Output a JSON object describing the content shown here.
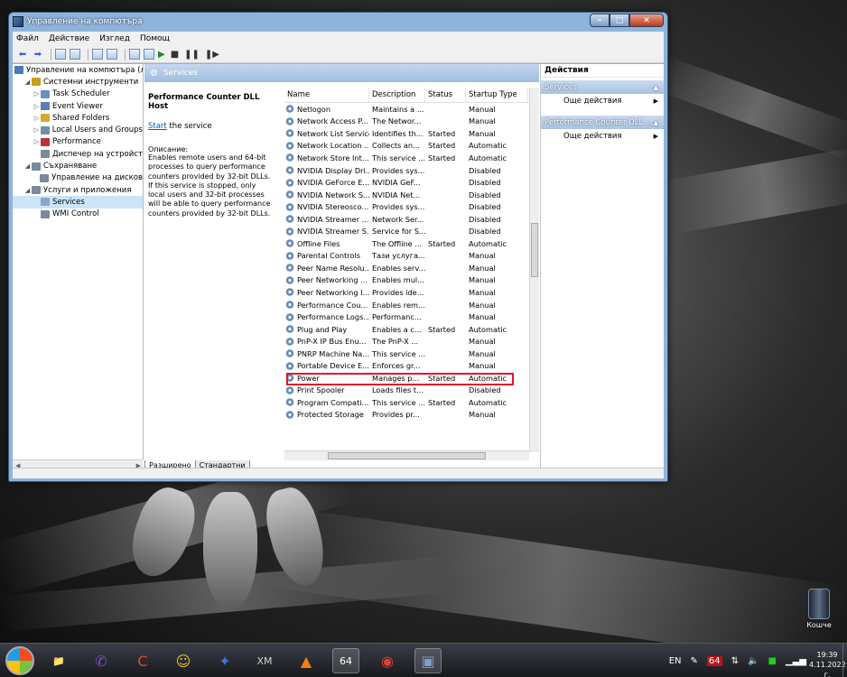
{
  "window": {
    "title": "Управление на компютъра",
    "controls": {
      "minimize": "–",
      "maximize": "□",
      "close": "✕"
    }
  },
  "menu": [
    "Файл",
    "Действие",
    "Изглед",
    "Помощ"
  ],
  "tree": [
    {
      "label": "Управление на компютъра (л",
      "level": 0,
      "expander": "",
      "icon_color": "#4a7ab8"
    },
    {
      "label": "Системни инструменти",
      "level": 1,
      "expander": "◢",
      "icon_color": "#c8a020"
    },
    {
      "label": "Task Scheduler",
      "level": 2,
      "expander": "▷",
      "icon_color": "#6a8fbf"
    },
    {
      "label": "Event Viewer",
      "level": 2,
      "expander": "▷",
      "icon_color": "#5a7fb0"
    },
    {
      "label": "Shared Folders",
      "level": 2,
      "expander": "▷",
      "icon_color": "#d7a832"
    },
    {
      "label": "Local Users and Groups",
      "level": 2,
      "expander": "▷",
      "icon_color": "#6f8fa8"
    },
    {
      "label": "Performance",
      "level": 2,
      "expander": "▷",
      "icon_color": "#c03030"
    },
    {
      "label": "Диспечер на устройст",
      "level": 2,
      "expander": "",
      "icon_color": "#7a8a9a"
    },
    {
      "label": "Съхраняване",
      "level": 1,
      "expander": "◢",
      "icon_color": "#7a8a9a"
    },
    {
      "label": "Управление на дисков",
      "level": 2,
      "expander": "",
      "icon_color": "#7a8a9a"
    },
    {
      "label": "Услуги и приложения",
      "level": 1,
      "expander": "◢",
      "icon_color": "#7a8a9a"
    },
    {
      "label": "Services",
      "level": 2,
      "expander": "",
      "icon_color": "#8aa8c8",
      "selected": true
    },
    {
      "label": "WMI Control",
      "level": 2,
      "expander": "",
      "icon_color": "#7a8a9a"
    }
  ],
  "center": {
    "header": "Services",
    "selected_service_title": "Performance Counter DLL Host",
    "start_link": "Start",
    "start_rest": " the service",
    "description_label": "Описание:",
    "description": "Enables remote users and 64-bit processes to query performance counters provided by 32-bit DLLs. If this service is stopped, only local users and 32-bit processes will be able to query performance counters provided by 32-bit DLLs.",
    "columns": {
      "name": "Name",
      "description": "Description",
      "status": "Status",
      "startup": "Startup Type"
    },
    "rows": [
      {
        "name": "Netlogon",
        "description": "Maintains a ...",
        "status": "",
        "startup": "Manual"
      },
      {
        "name": "Network Access P...",
        "description": "The Networ...",
        "status": "",
        "startup": "Manual"
      },
      {
        "name": "Network List Service",
        "description": "Identifies th...",
        "status": "Started",
        "startup": "Manual"
      },
      {
        "name": "Network Location ...",
        "description": "Collects an...",
        "status": "Started",
        "startup": "Automatic"
      },
      {
        "name": "Network Store Int...",
        "description": "This service ...",
        "status": "Started",
        "startup": "Automatic"
      },
      {
        "name": "NVIDIA Display Dri...",
        "description": "Provides sys...",
        "status": "",
        "startup": "Disabled"
      },
      {
        "name": "NVIDIA GeForce E...",
        "description": "NVIDIA GeF...",
        "status": "",
        "startup": "Disabled"
      },
      {
        "name": "NVIDIA Network S...",
        "description": "NVIDIA Net...",
        "status": "",
        "startup": "Disabled"
      },
      {
        "name": "NVIDIA Stereosco...",
        "description": "Provides sys...",
        "status": "",
        "startup": "Disabled"
      },
      {
        "name": "NVIDIA Streamer ...",
        "description": "Network Ser...",
        "status": "",
        "startup": "Disabled"
      },
      {
        "name": "NVIDIA Streamer S...",
        "description": "Service for S...",
        "status": "",
        "startup": "Disabled"
      },
      {
        "name": "Offline Files",
        "description": "The Offline ...",
        "status": "Started",
        "startup": "Automatic"
      },
      {
        "name": "Parental Controls",
        "description": "Тази услуга...",
        "status": "",
        "startup": "Manual"
      },
      {
        "name": "Peer Name Resolu...",
        "description": "Enables serv...",
        "status": "",
        "startup": "Manual"
      },
      {
        "name": "Peer Networking ...",
        "description": "Enables mul...",
        "status": "",
        "startup": "Manual"
      },
      {
        "name": "Peer Networking I...",
        "description": "Provides ide...",
        "status": "",
        "startup": "Manual"
      },
      {
        "name": "Performance Cou...",
        "description": "Enables rem...",
        "status": "",
        "startup": "Manual",
        "highlighted": true
      },
      {
        "name": "Performance Logs...",
        "description": "Performanc...",
        "status": "",
        "startup": "Manual"
      },
      {
        "name": "Plug and Play",
        "description": "Enables a c...",
        "status": "Started",
        "startup": "Automatic"
      },
      {
        "name": "PnP-X IP Bus Enu...",
        "description": "The PnP-X ...",
        "status": "",
        "startup": "Manual"
      },
      {
        "name": "PNRP Machine Na...",
        "description": "This service ...",
        "status": "",
        "startup": "Manual"
      },
      {
        "name": "Portable Device E...",
        "description": "Enforces gr...",
        "status": "",
        "startup": "Manual"
      },
      {
        "name": "Power",
        "description": "Manages p...",
        "status": "Started",
        "startup": "Automatic"
      },
      {
        "name": "Print Spooler",
        "description": "Loads files t...",
        "status": "",
        "startup": "Disabled"
      },
      {
        "name": "Program Compati...",
        "description": "This service ...",
        "status": "Started",
        "startup": "Automatic"
      },
      {
        "name": "Protected Storage",
        "description": "Provides pr...",
        "status": "",
        "startup": "Manual"
      }
    ],
    "tabs": [
      "Разширено",
      "Стандартни"
    ]
  },
  "actions": {
    "title": "Действия",
    "groups": [
      {
        "name": "Services",
        "more": "Още действия"
      },
      {
        "name": "Performance Counter DLL ...",
        "more": "Още действия"
      }
    ]
  },
  "taskbar": {
    "apps": [
      {
        "name": "explorer-icon",
        "glyph": "📁",
        "color": "#e2b44a"
      },
      {
        "name": "viber-icon",
        "glyph": "✆",
        "color": "#7d4ed1"
      },
      {
        "name": "ccleaner-icon",
        "glyph": "C",
        "color": "#d94a2e"
      },
      {
        "name": "yahoo-messenger-icon",
        "glyph": "☺",
        "color": "#f0c020"
      },
      {
        "name": "game-icon",
        "glyph": "✦",
        "color": "#3a7ad0"
      },
      {
        "name": "xmplay-icon",
        "glyph": "XM",
        "color": "#cfcfcf"
      },
      {
        "name": "vlc-icon",
        "glyph": "▲",
        "color": "#f08010"
      },
      {
        "name": "aida64-icon",
        "glyph": "64",
        "color": "#ffffff"
      },
      {
        "name": "chrome-icon",
        "glyph": "◉",
        "color": "#e04030"
      },
      {
        "name": "computer-management-icon",
        "glyph": "▣",
        "color": "#7aa0d0"
      }
    ],
    "tray": {
      "language": "EN",
      "aida": "64"
    },
    "clock": {
      "time": "19:39",
      "date": "4.11.2022 г."
    }
  },
  "desktop": {
    "recycle_bin_label": "Кошче"
  }
}
